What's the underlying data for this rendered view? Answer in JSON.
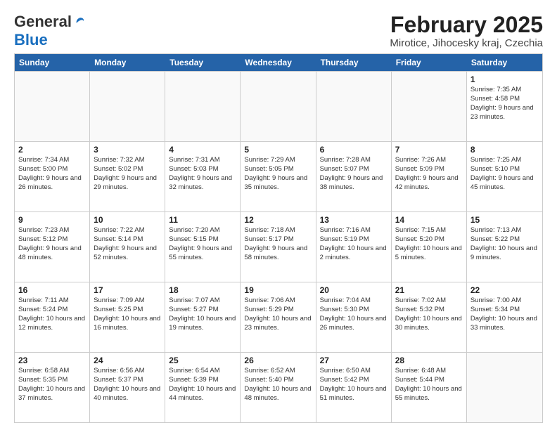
{
  "header": {
    "logo_general": "General",
    "logo_blue": "Blue",
    "title": "February 2025",
    "subtitle": "Mirotice, Jihocesky kraj, Czechia"
  },
  "weekdays": [
    "Sunday",
    "Monday",
    "Tuesday",
    "Wednesday",
    "Thursday",
    "Friday",
    "Saturday"
  ],
  "rows": [
    [
      {
        "day": "",
        "info": "",
        "empty": true
      },
      {
        "day": "",
        "info": "",
        "empty": true
      },
      {
        "day": "",
        "info": "",
        "empty": true
      },
      {
        "day": "",
        "info": "",
        "empty": true
      },
      {
        "day": "",
        "info": "",
        "empty": true
      },
      {
        "day": "",
        "info": "",
        "empty": true
      },
      {
        "day": "1",
        "info": "Sunrise: 7:35 AM\nSunset: 4:58 PM\nDaylight: 9 hours and 23 minutes.",
        "empty": false
      }
    ],
    [
      {
        "day": "2",
        "info": "Sunrise: 7:34 AM\nSunset: 5:00 PM\nDaylight: 9 hours and 26 minutes.",
        "empty": false
      },
      {
        "day": "3",
        "info": "Sunrise: 7:32 AM\nSunset: 5:02 PM\nDaylight: 9 hours and 29 minutes.",
        "empty": false
      },
      {
        "day": "4",
        "info": "Sunrise: 7:31 AM\nSunset: 5:03 PM\nDaylight: 9 hours and 32 minutes.",
        "empty": false
      },
      {
        "day": "5",
        "info": "Sunrise: 7:29 AM\nSunset: 5:05 PM\nDaylight: 9 hours and 35 minutes.",
        "empty": false
      },
      {
        "day": "6",
        "info": "Sunrise: 7:28 AM\nSunset: 5:07 PM\nDaylight: 9 hours and 38 minutes.",
        "empty": false
      },
      {
        "day": "7",
        "info": "Sunrise: 7:26 AM\nSunset: 5:09 PM\nDaylight: 9 hours and 42 minutes.",
        "empty": false
      },
      {
        "day": "8",
        "info": "Sunrise: 7:25 AM\nSunset: 5:10 PM\nDaylight: 9 hours and 45 minutes.",
        "empty": false
      }
    ],
    [
      {
        "day": "9",
        "info": "Sunrise: 7:23 AM\nSunset: 5:12 PM\nDaylight: 9 hours and 48 minutes.",
        "empty": false
      },
      {
        "day": "10",
        "info": "Sunrise: 7:22 AM\nSunset: 5:14 PM\nDaylight: 9 hours and 52 minutes.",
        "empty": false
      },
      {
        "day": "11",
        "info": "Sunrise: 7:20 AM\nSunset: 5:15 PM\nDaylight: 9 hours and 55 minutes.",
        "empty": false
      },
      {
        "day": "12",
        "info": "Sunrise: 7:18 AM\nSunset: 5:17 PM\nDaylight: 9 hours and 58 minutes.",
        "empty": false
      },
      {
        "day": "13",
        "info": "Sunrise: 7:16 AM\nSunset: 5:19 PM\nDaylight: 10 hours and 2 minutes.",
        "empty": false
      },
      {
        "day": "14",
        "info": "Sunrise: 7:15 AM\nSunset: 5:20 PM\nDaylight: 10 hours and 5 minutes.",
        "empty": false
      },
      {
        "day": "15",
        "info": "Sunrise: 7:13 AM\nSunset: 5:22 PM\nDaylight: 10 hours and 9 minutes.",
        "empty": false
      }
    ],
    [
      {
        "day": "16",
        "info": "Sunrise: 7:11 AM\nSunset: 5:24 PM\nDaylight: 10 hours and 12 minutes.",
        "empty": false
      },
      {
        "day": "17",
        "info": "Sunrise: 7:09 AM\nSunset: 5:25 PM\nDaylight: 10 hours and 16 minutes.",
        "empty": false
      },
      {
        "day": "18",
        "info": "Sunrise: 7:07 AM\nSunset: 5:27 PM\nDaylight: 10 hours and 19 minutes.",
        "empty": false
      },
      {
        "day": "19",
        "info": "Sunrise: 7:06 AM\nSunset: 5:29 PM\nDaylight: 10 hours and 23 minutes.",
        "empty": false
      },
      {
        "day": "20",
        "info": "Sunrise: 7:04 AM\nSunset: 5:30 PM\nDaylight: 10 hours and 26 minutes.",
        "empty": false
      },
      {
        "day": "21",
        "info": "Sunrise: 7:02 AM\nSunset: 5:32 PM\nDaylight: 10 hours and 30 minutes.",
        "empty": false
      },
      {
        "day": "22",
        "info": "Sunrise: 7:00 AM\nSunset: 5:34 PM\nDaylight: 10 hours and 33 minutes.",
        "empty": false
      }
    ],
    [
      {
        "day": "23",
        "info": "Sunrise: 6:58 AM\nSunset: 5:35 PM\nDaylight: 10 hours and 37 minutes.",
        "empty": false
      },
      {
        "day": "24",
        "info": "Sunrise: 6:56 AM\nSunset: 5:37 PM\nDaylight: 10 hours and 40 minutes.",
        "empty": false
      },
      {
        "day": "25",
        "info": "Sunrise: 6:54 AM\nSunset: 5:39 PM\nDaylight: 10 hours and 44 minutes.",
        "empty": false
      },
      {
        "day": "26",
        "info": "Sunrise: 6:52 AM\nSunset: 5:40 PM\nDaylight: 10 hours and 48 minutes.",
        "empty": false
      },
      {
        "day": "27",
        "info": "Sunrise: 6:50 AM\nSunset: 5:42 PM\nDaylight: 10 hours and 51 minutes.",
        "empty": false
      },
      {
        "day": "28",
        "info": "Sunrise: 6:48 AM\nSunset: 5:44 PM\nDaylight: 10 hours and 55 minutes.",
        "empty": false
      },
      {
        "day": "",
        "info": "",
        "empty": true
      }
    ]
  ]
}
